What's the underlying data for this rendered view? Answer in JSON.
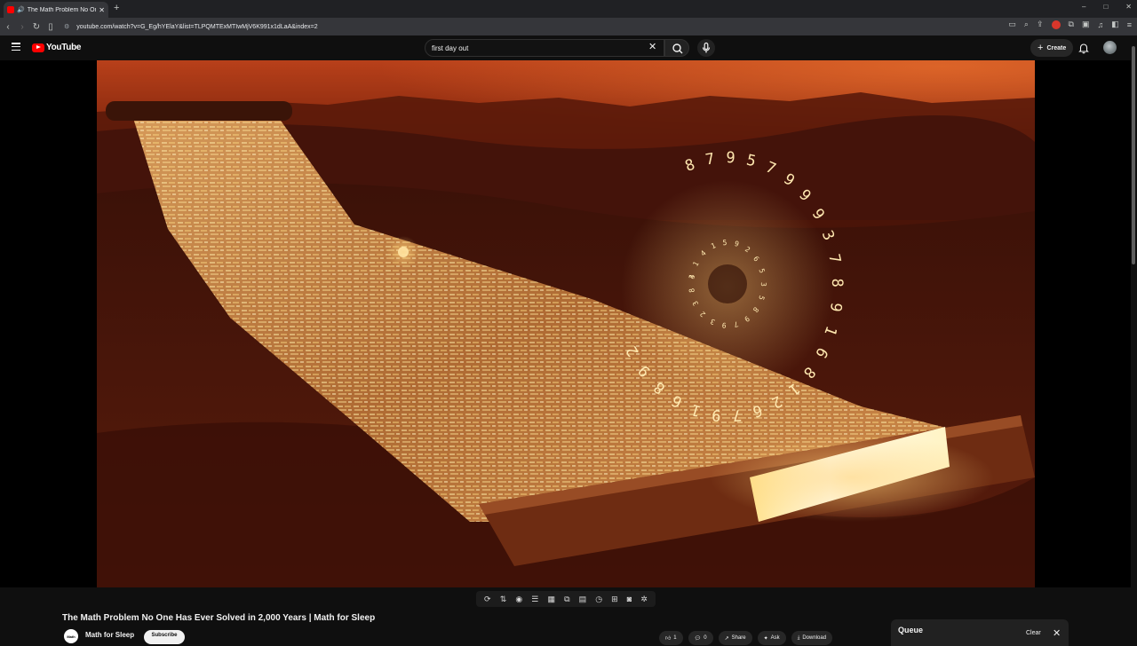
{
  "browser": {
    "tab_title": "The Math Problem No One H",
    "new_tab_symbol": "+",
    "url": "youtube.com/watch?v=G_Eg/hYElaY&list=TLPQMTExMTIwMjV6K991x1dLaA&index=2",
    "window_controls": [
      "–",
      "□",
      "✕"
    ]
  },
  "youtube": {
    "logo_text": "YouTube",
    "search_query": "first day out",
    "create_label": "Create"
  },
  "video": {
    "title": "The Math Problem No One Has Ever Solved in 2,000 Years | Math for Sleep",
    "channel_name": "Math for Sleep",
    "channel_avatar_text": "Math",
    "subscribe_label": "Subscribe"
  },
  "actions": {
    "like_count": "1",
    "comment_count": "0",
    "share_label": "Share",
    "ask_label": "Ask",
    "download_label": "Download"
  },
  "queue": {
    "title": "Queue",
    "clear_label": "Clear"
  },
  "colors": {
    "yt_red": "#ff0000",
    "background": "#0f0f0f",
    "scroll_glow": "#fff3c4"
  },
  "scroll_digits_outer": "8795799937891681267916892",
  "scroll_digits_inner": "31415926535897932384"
}
